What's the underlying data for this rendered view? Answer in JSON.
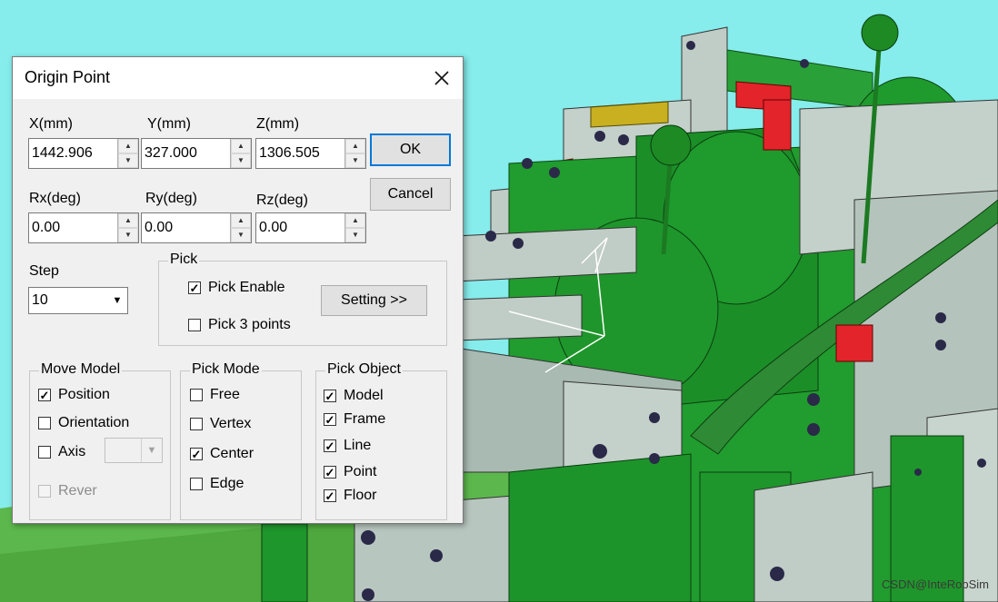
{
  "dialog": {
    "title": "Origin Point",
    "close_glyph": "✕",
    "x_label": "X(mm)",
    "y_label": "Y(mm)",
    "z_label": "Z(mm)",
    "x_value": "1442.906",
    "y_value": "327.000",
    "z_value": "1306.505",
    "rx_label": "Rx(deg)",
    "ry_label": "Ry(deg)",
    "rz_label": "Rz(deg)",
    "rx_value": "0.00",
    "ry_value": "0.00",
    "rz_value": "0.00",
    "ok_label": "OK",
    "cancel_label": "Cancel",
    "step_label": "Step",
    "step_value": "10",
    "pick": {
      "legend": "Pick",
      "enable_label": "Pick Enable",
      "enable_checked": true,
      "three_points_label": "Pick 3 points",
      "three_points_checked": false,
      "setting_label": "Setting >>"
    },
    "move_model": {
      "legend": "Move Model",
      "items": [
        {
          "label": "Position",
          "checked": true,
          "enabled": true
        },
        {
          "label": "Orientation",
          "checked": false,
          "enabled": true
        },
        {
          "label": "Axis",
          "checked": false,
          "enabled": true
        },
        {
          "label": "Rever",
          "checked": false,
          "enabled": false
        }
      ]
    },
    "pick_mode": {
      "legend": "Pick Mode",
      "items": [
        {
          "label": "Free",
          "checked": false
        },
        {
          "label": "Vertex",
          "checked": false
        },
        {
          "label": "Center",
          "checked": true
        },
        {
          "label": "Edge",
          "checked": false
        }
      ]
    },
    "pick_object": {
      "legend": "Pick Object",
      "items": [
        {
          "label": "Model",
          "checked": true
        },
        {
          "label": "Frame",
          "checked": true
        },
        {
          "label": "Line",
          "checked": true
        },
        {
          "label": "Point",
          "checked": true
        },
        {
          "label": "Floor",
          "checked": true
        }
      ]
    }
  },
  "watermark": "CSDN@InteRobSim",
  "colors": {
    "sky": "#87eeee",
    "ground": "#58b848",
    "model_green": "#1e9e2a",
    "plate_gray": "#b4c4bc",
    "accent_red": "#e0222a"
  }
}
